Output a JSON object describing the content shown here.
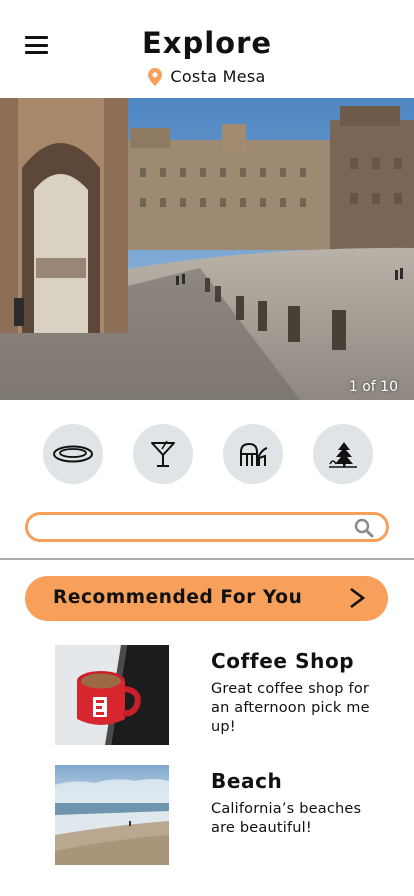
{
  "header": {
    "title": "Explore",
    "location": "Costa Mesa",
    "accent_color": "#f6a05c"
  },
  "hero": {
    "counter": "1 of 10",
    "current_index": 1,
    "total": 10
  },
  "categories": [
    {
      "icon": "plate-icon"
    },
    {
      "icon": "cocktail-icon"
    },
    {
      "icon": "amusement-icon"
    },
    {
      "icon": "nature-icon"
    }
  ],
  "search": {
    "value": "",
    "placeholder": "",
    "icon": "search-icon"
  },
  "recommended": {
    "label": "Recommended For You",
    "arrow": "chevron-right-icon"
  },
  "items": [
    {
      "title": "Coffee Shop",
      "description": "Great coffee shop for an afternoon pick me up!"
    },
    {
      "title": "Beach",
      "description": "California’s beaches are beautiful!"
    }
  ]
}
